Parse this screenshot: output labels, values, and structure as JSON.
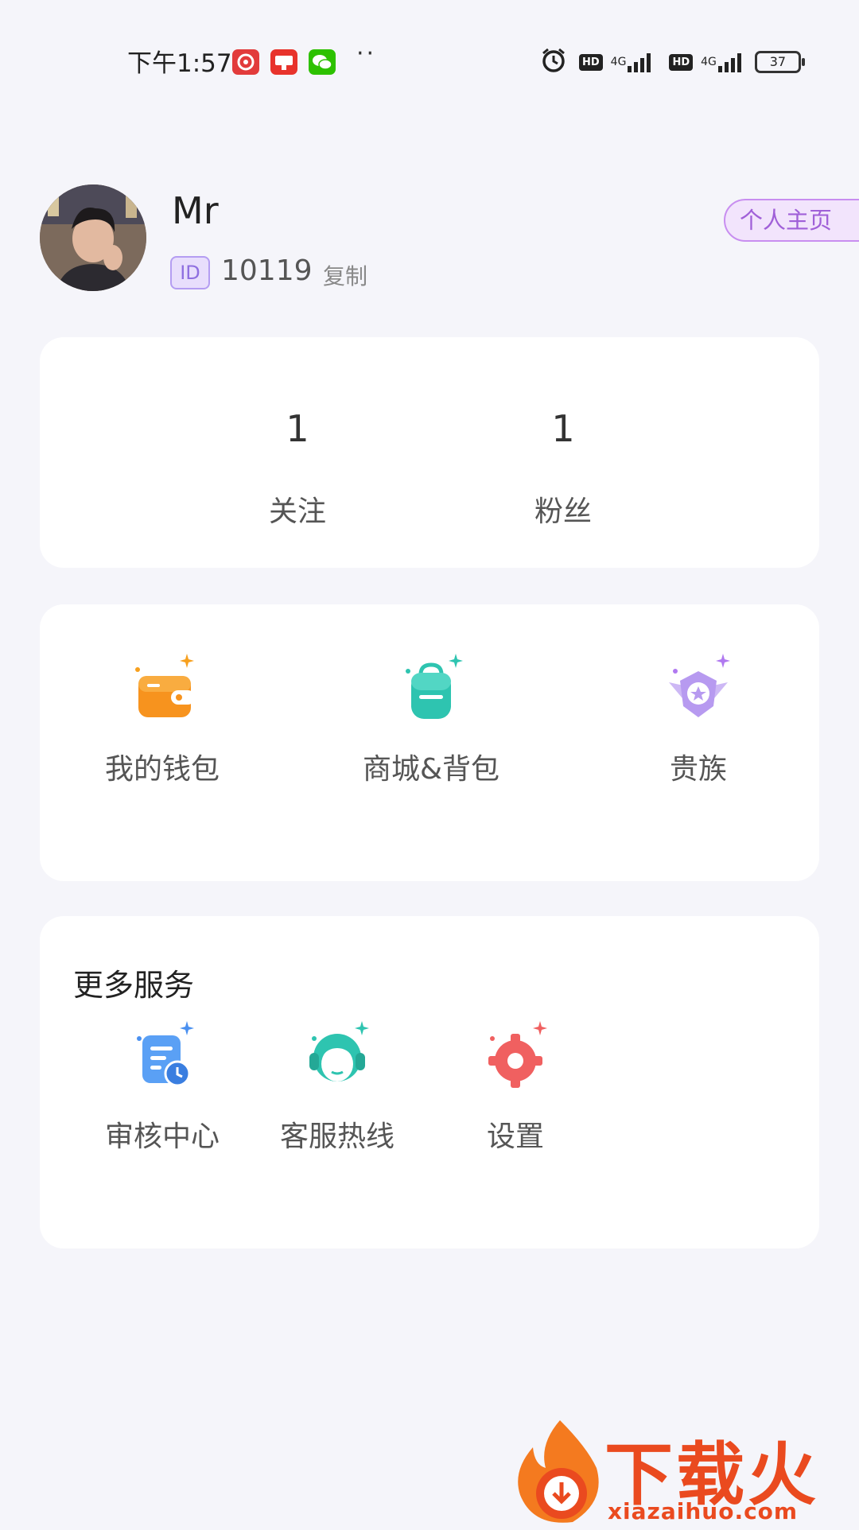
{
  "status_bar": {
    "time": "下午1:57",
    "dots": "··",
    "hd1": "HD",
    "net1": "4G",
    "hd2": "HD",
    "net2": "4G",
    "battery": "37"
  },
  "profile": {
    "username": "Mr",
    "id_label": "ID",
    "id_number": "10119",
    "copy_label": "复制",
    "homepage_label": "个人主页"
  },
  "stats": [
    {
      "value": "1",
      "label": "关注"
    },
    {
      "value": "1",
      "label": "粉丝"
    }
  ],
  "features": [
    {
      "label": "我的钱包",
      "icon": "wallet-icon"
    },
    {
      "label": "商城&背包",
      "icon": "backpack-icon"
    },
    {
      "label": "贵族",
      "icon": "noble-badge-icon"
    }
  ],
  "services": {
    "title": "更多服务",
    "items": [
      {
        "label": "审核中心",
        "icon": "review-document-icon"
      },
      {
        "label": "客服热线",
        "icon": "customer-service-icon"
      },
      {
        "label": "设置",
        "icon": "settings-gear-icon"
      }
    ]
  },
  "watermark": {
    "text": "下载火",
    "url": "xiazaihuo.com"
  },
  "colors": {
    "background": "#f5f5fa",
    "accent_purple": "#a060d8",
    "wallet_orange": "#f7931e",
    "teal": "#2ec4b0",
    "lavender": "#b79af0",
    "blue": "#4a90f0",
    "red": "#f06060",
    "watermark_red": "#ea4a1f"
  }
}
